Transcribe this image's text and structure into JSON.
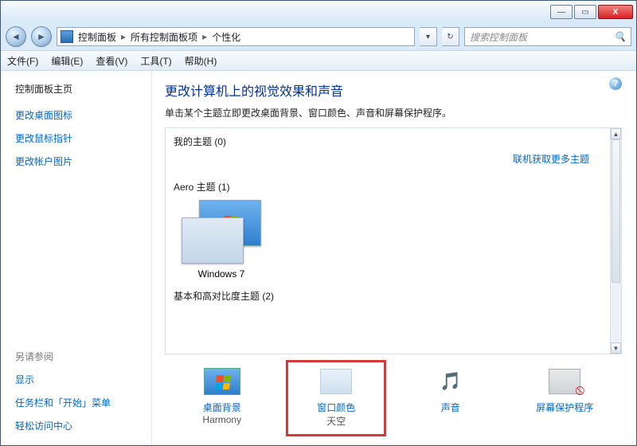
{
  "titlebar": {
    "min": "—",
    "max": "▭",
    "close": "X"
  },
  "nav": {
    "back": "◄",
    "forward": "►",
    "refresh": "↻",
    "dropdown": "▾"
  },
  "breadcrumb": {
    "icon": "control-panel",
    "parts": [
      "控制面板",
      "所有控制面板项",
      "个性化"
    ],
    "sep": "▸"
  },
  "search": {
    "placeholder": "搜索控制面板",
    "icon": "🔍"
  },
  "menu": {
    "file": "文件(F)",
    "edit": "编辑(E)",
    "view": "查看(V)",
    "tools": "工具(T)",
    "help": "帮助(H)"
  },
  "sidebar": {
    "home": "控制面板主页",
    "tasks": [
      "更改桌面图标",
      "更改鼠标指针",
      "更改帐户图片"
    ],
    "seealso_h": "另请参阅",
    "seealso": [
      "显示",
      "任务栏和「开始」菜单",
      "轻松访问中心"
    ]
  },
  "main": {
    "title": "更改计算机上的视觉效果和声音",
    "instruction": "单击某个主题立即更改桌面背景、窗口颜色、声音和屏幕保护程序。",
    "help": "?",
    "sections": {
      "my_themes": {
        "label": "我的主题 (0)",
        "count": 0
      },
      "get_more": "联机获取更多主题",
      "aero": {
        "label": "Aero 主题 (1)",
        "count": 1,
        "items": [
          {
            "name": "Windows 7"
          }
        ]
      },
      "basic": {
        "label": "基本和高对比度主题 (2)",
        "count": 2
      }
    }
  },
  "bottom": {
    "desktop_bg": {
      "title": "桌面背景",
      "value": "Harmony"
    },
    "window_color": {
      "title": "窗口颜色",
      "value": "天空"
    },
    "sounds": {
      "title": "声音",
      "value": ""
    },
    "screensaver": {
      "title": "屏幕保护程序",
      "value": ""
    }
  }
}
